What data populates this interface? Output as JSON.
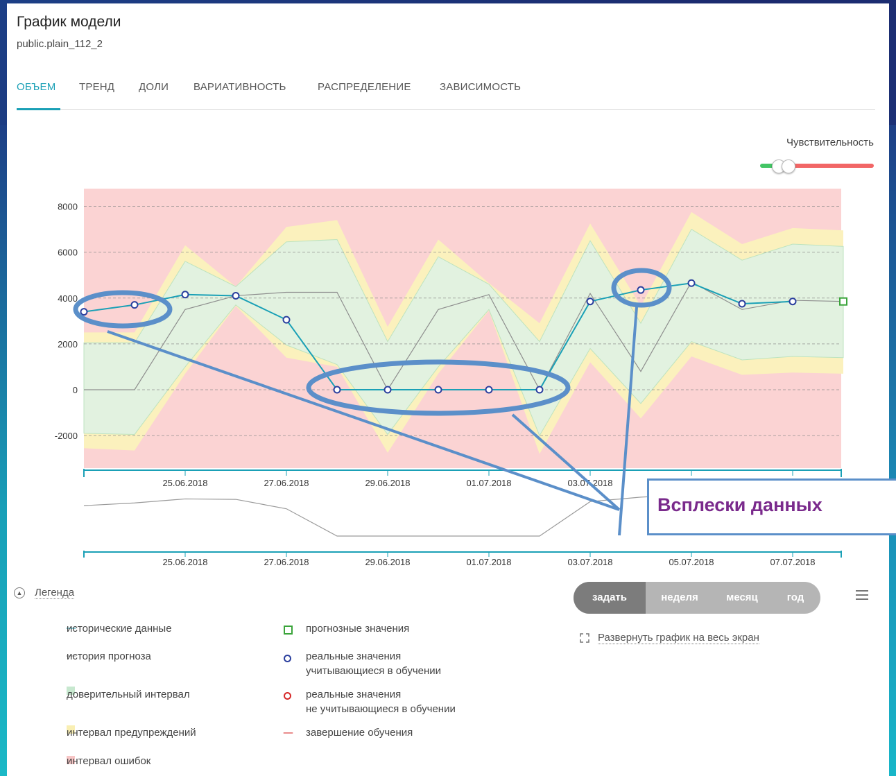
{
  "header": {
    "title": "График модели",
    "subtitle": "public.plain_112_2"
  },
  "tabs": [
    {
      "label": "ОБЪЕМ",
      "active": true
    },
    {
      "label": "ТРЕНД"
    },
    {
      "label": "ДОЛИ"
    },
    {
      "label": "ВАРИАТИВНОСТЬ"
    },
    {
      "label": "РАСПРЕДЕЛЕНИЕ"
    },
    {
      "label": "ЗАВИСИМОСТЬ"
    }
  ],
  "sensitivity": {
    "label": "Чувствительность",
    "value": 0.2
  },
  "legend": {
    "toggle_label": "Легенда",
    "items": [
      {
        "symbol": "—",
        "color": "#1aa0b6",
        "label": "исторические данные"
      },
      {
        "symbol": "—",
        "color": "#9a9a9a",
        "label": "история прогноза"
      },
      {
        "symbol": "■",
        "color": "#c7e8cf",
        "label": "доверительный интервал"
      },
      {
        "symbol": "■",
        "color": "#f9efb3",
        "label": "интервал предупреждений"
      },
      {
        "symbol": "■",
        "color": "#f7c6c6",
        "label": "интервал ошибок"
      },
      {
        "symbol": "□",
        "color": "#3aa43a",
        "label": "прогнозные значения"
      },
      {
        "symbol": "o",
        "color": "#2b3f9e",
        "label_line1": "реальные значения",
        "label_line2": "учитывающиеся в обучении"
      },
      {
        "symbol": "o",
        "color": "#d62828",
        "label_line1": "реальные значения",
        "label_line2": "не учитывающиеся в обучении"
      },
      {
        "symbol": "—",
        "color": "#d62828",
        "label": "завершение обучения"
      }
    ]
  },
  "period_selector": {
    "options": [
      "задать",
      "неделя",
      "месяц",
      "год"
    ],
    "active": "задать"
  },
  "expand_label": "Развернуть график на весь экран",
  "annotation": {
    "text": "Всплески данных"
  },
  "chart_data": {
    "type": "line",
    "ylim": [
      -3000,
      8500
    ],
    "yticks": [
      -2000,
      0,
      2000,
      4000,
      6000,
      8000
    ],
    "xlabels": [
      "25.06.2018",
      "27.06.2018",
      "29.06.2018",
      "01.07.2018",
      "03.07.2018",
      "05.07.2018",
      "07.07.2018"
    ],
    "x": [
      "23.06.2018",
      "24.06.2018",
      "25.06.2018",
      "26.06.2018",
      "27.06.2018",
      "28.06.2018",
      "29.06.2018",
      "30.06.2018",
      "01.07.2018",
      "02.07.2018",
      "03.07.2018",
      "04.07.2018",
      "05.07.2018",
      "06.07.2018",
      "07.07.2018",
      "08.07.2018"
    ],
    "series": [
      {
        "values": [
          3400,
          3700,
          4150,
          4100,
          3050,
          0,
          0,
          0,
          0,
          0,
          3850,
          4350,
          4650,
          3750,
          3850,
          null
        ]
      },
      {
        "values": [
          0,
          0,
          3500,
          4100,
          4250,
          4250,
          0,
          3500,
          4150,
          0,
          4200,
          800,
          4700,
          3500,
          3900,
          3850
        ]
      }
    ],
    "confidence_interval": {
      "upper": [
        2050,
        2050,
        5600,
        4500,
        6450,
        6550,
        2100,
        5800,
        4600,
        2100,
        6500,
        2900,
        7000,
        5650,
        6350,
        6250
      ],
      "lower": [
        -1900,
        -1950,
        1000,
        3700,
        1950,
        1100,
        -1950,
        1000,
        3500,
        -2000,
        1800,
        -600,
        2100,
        1300,
        1450,
        1400
      ]
    },
    "warning_interval": {
      "upper": [
        2500,
        2500,
        6300,
        4500,
        7100,
        7400,
        2750,
        6550,
        4650,
        2900,
        7250,
        3650,
        7750,
        6350,
        7050,
        6950
      ],
      "lower": [
        -2550,
        -2650,
        700,
        3650,
        1400,
        1000,
        -2750,
        700,
        3450,
        -2800,
        1200,
        -1250,
        1450,
        650,
        750,
        700
      ]
    },
    "forecast_point": {
      "x": "08.07.2018",
      "value": 3850
    },
    "navigator_values": [
      3400,
      3700,
      4150,
      4100,
      3050,
      0,
      0,
      0,
      0,
      0,
      3850,
      4350,
      4650,
      3750,
      3850,
      3850
    ]
  }
}
